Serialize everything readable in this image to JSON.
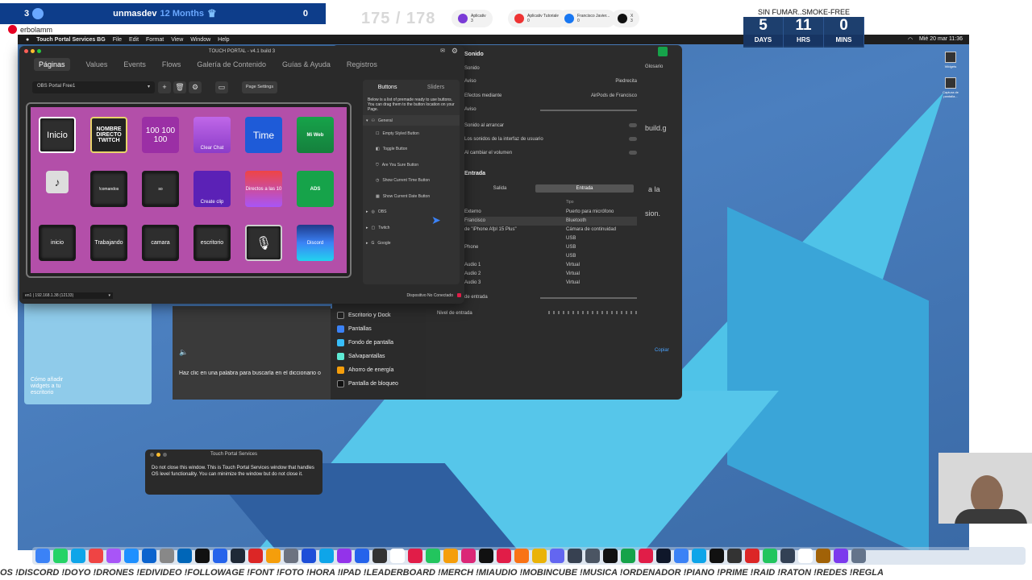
{
  "overlay": {
    "top_left": {
      "count": "3",
      "name": "unmasdev",
      "months": "12 Months",
      "right_count": "0"
    },
    "pinterest_user": "erbolamm",
    "counter": "175 / 178",
    "socials": [
      {
        "label": "Aplicativ",
        "count": "3",
        "color": "#7a3bd6"
      },
      {
        "label": "Aplicativ Tutoriales",
        "count": "0",
        "color": "#e33"
      },
      {
        "label": "Francisco Javier...",
        "count": "0",
        "color": "#1877f2"
      },
      {
        "label": "X",
        "count": "3",
        "color": "#111"
      }
    ],
    "countdown": {
      "title": "SIN FUMAR..SMOKE-FREE",
      "days": "5",
      "hrs": "11",
      "mins": "0",
      "days_label": "DAYS",
      "hrs_label": "HRS",
      "mins_label": "MINS"
    }
  },
  "menubar": {
    "app": "Touch Portal Services BG",
    "items": [
      "File",
      "Edit",
      "Format",
      "View",
      "Window",
      "Help"
    ],
    "clock": "Mié 20 mar 11:36"
  },
  "touchportal": {
    "title": "TOUCH PORTAL - v4.1 build 3",
    "tabs": [
      "Páginas",
      "Values",
      "Events",
      "Flows",
      "Galería de Contenido",
      "Guías & Ayuda",
      "Registros"
    ],
    "page_select": "OBS Portal Free1",
    "page_settings": "Page Settings",
    "buttons": [
      [
        "Inicio",
        "NOMBRE DIRECTO TWITCH",
        "100 100 100",
        "Clear Chat",
        "Time",
        "Mi Web"
      ],
      [
        "♪",
        "!comandos",
        "so",
        "Create clip",
        "Directos a las 10",
        "ADS"
      ],
      [
        "inicio",
        "Trabajando",
        "camara",
        "escritorio",
        "🎙",
        "Discord"
      ]
    ],
    "panel": {
      "tabs": [
        "Buttons",
        "Sliders"
      ],
      "desc": "Below is a list of premade ready to use buttons. You can drag them to the button location on your Page.",
      "tree_root": "General",
      "items": [
        "Empty Styled Button",
        "Toggle Button",
        "Are You Sure Button",
        "Show Current Time Button",
        "Show Current Date Button"
      ],
      "groups": [
        "OBS",
        "Twitch",
        "Google"
      ]
    },
    "status_left": "en1 | 192.168.1.38 (12133)",
    "status_right": "Dispositivo No Conectado"
  },
  "settings": {
    "title": "Sonido",
    "rows": [
      {
        "label": "Sonido",
        "value": ""
      },
      {
        "label": "Aviso",
        "value": "Piedrecita"
      },
      {
        "label": "Efectos mediante",
        "value": "AirPods de Francisco"
      },
      {
        "label": "Aviso",
        "value": ""
      },
      {
        "label": "Sonido al arrancar",
        "value": ""
      },
      {
        "label": "Los sonidos de la interfaz de usuario",
        "value": ""
      },
      {
        "label": "Al cambiar el volumen",
        "value": ""
      }
    ],
    "section": "Entrada",
    "seg": [
      "Salida",
      "Entrada"
    ],
    "col_tipo": "Tipo",
    "table": [
      [
        "Externo",
        "Puerto para micrófono"
      ],
      [
        "Francisco",
        "Bluetooth"
      ],
      [
        "de \"iPhone Afpl 15 Plus\"",
        "Cámara de continuidad"
      ],
      [
        "",
        "USB"
      ],
      [
        "Phone",
        "USB"
      ],
      [
        "",
        "USB"
      ],
      [
        "Audio 1",
        "Virtual"
      ],
      [
        "Audio 2",
        "Virtual"
      ],
      [
        "Audio 3",
        "Virtual"
      ]
    ],
    "entrada_vol": "de entrada",
    "nivel": "Nivel de entrada",
    "side_text": [
      "Glosario",
      "build.g",
      "a la",
      "sion."
    ],
    "copiar": "Copiar"
  },
  "dictionary": {
    "hint": "Haz clic en una palabra para buscarla en el diccionario o"
  },
  "sidemenu": [
    {
      "label": "Escritorio y Dock",
      "color": "#222"
    },
    {
      "label": "Pantallas",
      "color": "#3b82f6"
    },
    {
      "label": "Fondo de pantalla",
      "color": "#38bdf8"
    },
    {
      "label": "Salvapantallas",
      "color": "#5eead4"
    },
    {
      "label": "Ahorro de energía",
      "color": "#f59e0b"
    },
    {
      "label": "Pantalla de bloqueo",
      "color": "#111"
    }
  ],
  "widget": {
    "text": "Cómo añadir widgets a tu escritorio"
  },
  "tps": {
    "title": "Touch Portal Services",
    "body": "Do not close this window. This is Touch Portal Services window that handles OS level functionality. You can minimize the window but do not close it."
  },
  "desktop_icons": [
    "Widgets",
    "Captura de pantalla..."
  ],
  "ticker": "OS !DISCORD !DOYO !DRONES !EDIVIDEO !FOLLOWAGE !FONT !FOTO !HORA !IPAD !LEADERBOARD !MERCH !MIAUDIO !MOBINCUBE !MUSICA !ORDENADOR !PIANO !PRIME !RAID !RATON !REDES !REGLA",
  "dock_colors": [
    "#3b82f6",
    "#25d366",
    "#0ea5e9",
    "#ef4444",
    "#a855f7",
    "#1e90ff",
    "#0b63ce",
    "#888",
    "#0066b8",
    "#111",
    "#2563eb",
    "#1f2937",
    "#dc2626",
    "#f59e0b",
    "#6b7280",
    "#1d4ed8",
    "#0ea5e9",
    "#9333ea",
    "#2563eb",
    "#333",
    "#fff",
    "#e11d48",
    "#22c55e",
    "#f59e0b",
    "#db2777",
    "#111",
    "#e11d48",
    "#f97316",
    "#eab308",
    "#6366f1",
    "#374151",
    "#4b5563",
    "#111",
    "#16a34a",
    "#e11d48",
    "#0f172a",
    "#3b82f6",
    "#0ea5e9",
    "#111",
    "#333",
    "#dc2626",
    "#22c55e",
    "#334155",
    "#fff",
    "#a16207",
    "#7c3aed",
    "#64748b"
  ]
}
